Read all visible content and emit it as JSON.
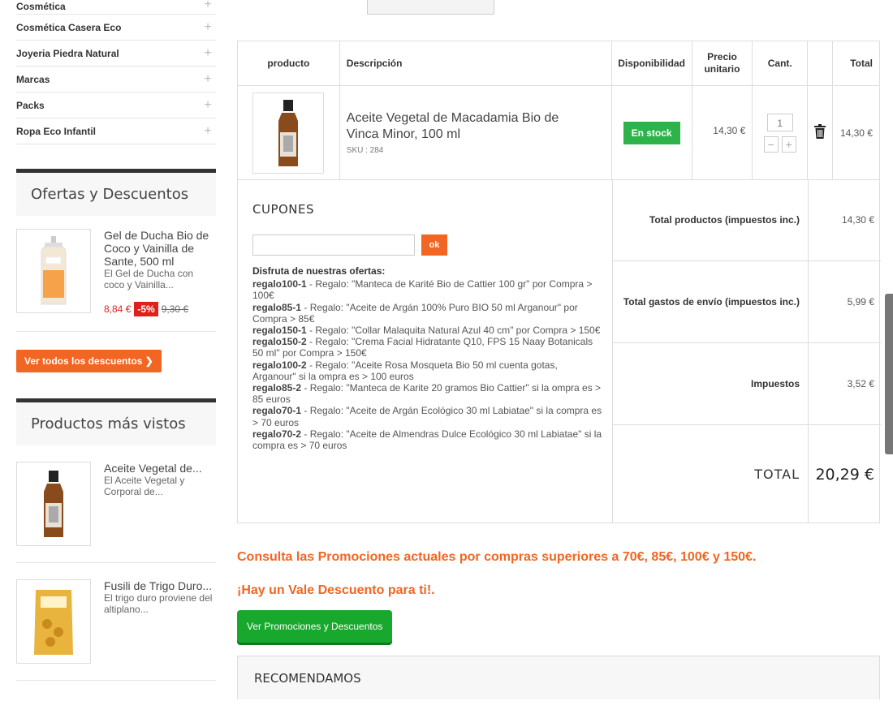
{
  "sidebar": {
    "categories": [
      "Cosmética",
      "Cosmética Casera Eco",
      "Joyeria Piedra Natural",
      "Marcas",
      "Packs",
      "Ropa Eco Infantil"
    ],
    "plus_glyph": "+",
    "offers": {
      "title": "Ofertas y Descuentos",
      "item": {
        "name": "Gel de Ducha Bio de Coco y Vainilla de Sante, 500 ml",
        "desc": "El Gel de Ducha con coco y Vainilla...",
        "price_new": "8,84 €",
        "discount": "-5%",
        "price_old": "9,30 €"
      },
      "button": "Ver todos los descuentos ❯"
    },
    "viewed": {
      "title": "Productos más vistos",
      "items": [
        {
          "name": "Aceite Vegetal de...",
          "desc": "El Aceite Vegetal y Corporal de..."
        },
        {
          "name": "Fusili de Trigo Duro...",
          "desc": "El trigo duro proviene del altiplano..."
        }
      ]
    }
  },
  "cart": {
    "headers": {
      "product": "producto",
      "description": "Descripción",
      "availability": "Disponibilidad",
      "unit_price": "Precio unitario",
      "qty": "Cant.",
      "total": "Total"
    },
    "item": {
      "name": "Aceite Vegetal de Macadamia Bio de Vinca Minor, 100 ml",
      "sku": "SKU : 284",
      "stock": "En stock",
      "unit_price": "14,30 €",
      "qty": "1",
      "total": "14,30 €"
    }
  },
  "coupons": {
    "title": "CUPONES",
    "ok": "ok",
    "intro": "Disfruta de nuestras ofertas:",
    "promos": [
      {
        "code": "regalo100-1",
        "text": " - Regalo: \"Manteca de Karité Bio de Cattier 100 gr\" por Compra > 100€"
      },
      {
        "code": "regalo85-1",
        "text": " - Regalo: \"Aceite de Argán 100% Puro BIO 50 ml Arganour\" por Compra > 85€"
      },
      {
        "code": "regalo150-1",
        "text": " - Regalo: \"Collar Malaquita Natural Azul 40 cm\" por Compra > 150€"
      },
      {
        "code": "regalo150-2",
        "text": " - Regalo: \"Crema Facial Hidratante Q10, FPS 15 Naay Botanicals 50 ml\" por Compra > 150€"
      },
      {
        "code": "regalo100-2",
        "text": " - Regalo: \"Aceite Rosa Mosqueta Bio 50 ml cuenta gotas, Arganour\" si la ompra es > 100 euros"
      },
      {
        "code": "regalo85-2",
        "text": " - Regalo: \"Manteca de Karite 20 gramos Bio Cattier\" si la ompra es > 85 euros"
      },
      {
        "code": "regalo70-1",
        "text": " - Regalo: \"Aceite de Argán Ecológico 30 ml Labiatae\" si la compra es > 70 euros"
      },
      {
        "code": "regalo70-2",
        "text": " - Regalo: \"Aceite de Almendras Dulce Ecológico 30 ml Labiatae\" si la compra es > 70 euros"
      }
    ]
  },
  "totals": {
    "products_label": "Total productos (impuestos inc.)",
    "products_value": "14,30 €",
    "shipping_label": "Total gastos de envío (impuestos inc.)",
    "shipping_value": "5,99 €",
    "tax_label": "Impuestos",
    "tax_value": "3,52 €",
    "total_label": "TOTAL",
    "total_value": "20,29 €"
  },
  "promo_text_1": "Consulta las Promociones actuales por compras superiores a 70€, 85€, 100€ y 150€.",
  "promo_text_2": "¡Hay un Vale Descuento para ti!.",
  "promo_button": "Ver Promociones y Descuentos",
  "recommend_title": "RECOMENDAMOS",
  "icons": {
    "trash": "trash-icon",
    "minus": "minus-icon",
    "plus": "plus-icon"
  }
}
